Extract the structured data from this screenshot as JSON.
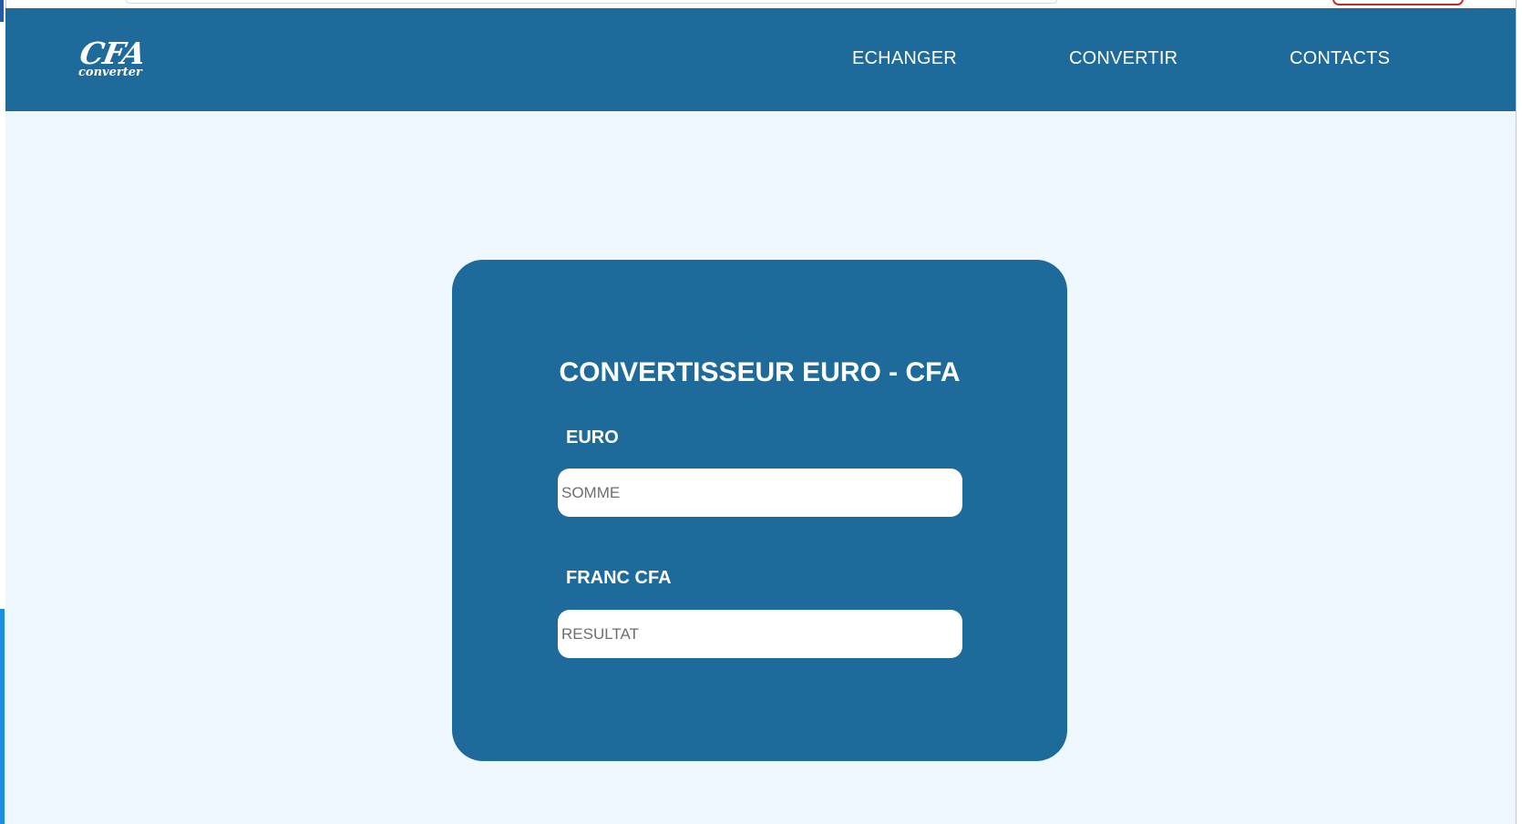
{
  "colors": {
    "primary": "#1e6b9b",
    "page_background": "#eef7fe",
    "text_on_primary": "#ffffff"
  },
  "header": {
    "logo": {
      "main": "CFA",
      "sub": "converter"
    },
    "nav": [
      {
        "label": "ECHANGER"
      },
      {
        "label": "CONVERTIR"
      },
      {
        "label": "CONTACTS"
      }
    ]
  },
  "converter": {
    "title": "CONVERTISSEUR EURO - CFA",
    "euro": {
      "label": "EURO",
      "placeholder": "SOMME",
      "value": ""
    },
    "cfa": {
      "label": "FRANC CFA",
      "placeholder": "RESULTAT",
      "value": ""
    }
  }
}
